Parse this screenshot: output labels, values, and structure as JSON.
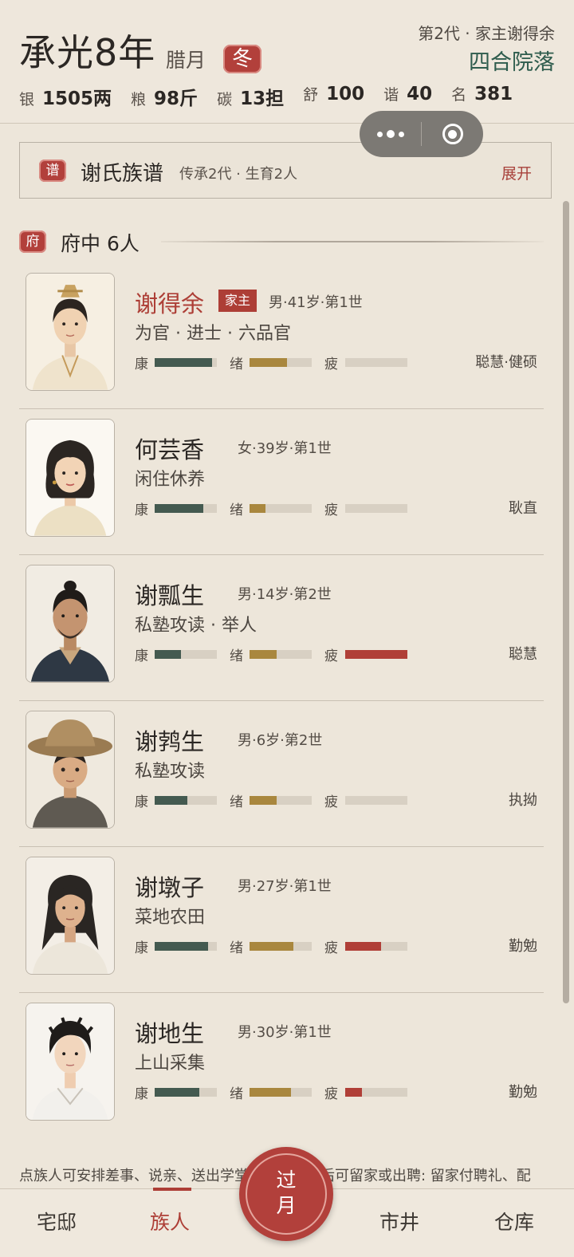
{
  "header": {
    "year": "承光8年",
    "month": "腊月",
    "season": "冬",
    "generation": "第2代 · 家主谢得余",
    "estate": "四合院落",
    "resources": [
      {
        "label": "银",
        "value": "1505两"
      },
      {
        "label": "粮",
        "value": "98斤"
      },
      {
        "label": "碳",
        "value": "13担"
      },
      {
        "label": "舒",
        "value": "100"
      },
      {
        "label": "谐",
        "value": "40"
      },
      {
        "label": "名",
        "value": "381"
      }
    ]
  },
  "genealogy": {
    "seal": "谱",
    "title": "谢氏族谱",
    "subtitle": "传承2代 · 生育2人",
    "expand": "展开"
  },
  "household": {
    "seal": "府",
    "title": "府中 6人"
  },
  "stat_labels": {
    "health": "康",
    "mood": "绪",
    "fatigue": "疲"
  },
  "colors": {
    "health": "#445a50",
    "mood": "#a9873e",
    "fatigue": "#b03f37",
    "accent": "#ad3e36"
  },
  "members": [
    {
      "name": "谢得余",
      "badge": "家主",
      "meta": "男·41岁·第1世",
      "occupation": "为官 · 进士 · 六品官",
      "traits": "聪慧·健硕",
      "health": 0.92,
      "mood": 0.6,
      "fatigue": 0.0,
      "portrait": "official-man"
    },
    {
      "name": "何芸香",
      "badge": "",
      "meta": "女·39岁·第1世",
      "occupation": "闲住休养",
      "traits": "耿直",
      "health": 0.78,
      "mood": 0.25,
      "fatigue": 0.0,
      "portrait": "woman"
    },
    {
      "name": "谢瓢生",
      "badge": "",
      "meta": "男·14岁·第2世",
      "occupation": "私塾攻读 · 举人",
      "traits": "聪慧",
      "health": 0.42,
      "mood": 0.43,
      "fatigue": 1.0,
      "portrait": "bearded-man"
    },
    {
      "name": "谢鹁生",
      "badge": "",
      "meta": "男·6岁·第2世",
      "occupation": "私塾攻读",
      "traits": "执拗",
      "health": 0.52,
      "mood": 0.44,
      "fatigue": 0.0,
      "portrait": "child-straw-hat"
    },
    {
      "name": "谢墩子",
      "badge": "",
      "meta": "男·27岁·第1世",
      "occupation": "菜地农田",
      "traits": "勤勉",
      "health": 0.86,
      "mood": 0.7,
      "fatigue": 0.58,
      "portrait": "long-hair-man"
    },
    {
      "name": "谢地生",
      "badge": "",
      "meta": "男·30岁·第1世",
      "occupation": "上山采集",
      "traits": "勤勉",
      "health": 0.72,
      "mood": 0.67,
      "fatigue": 0.27,
      "portrait": "young-man"
    }
  ],
  "footer_note": "点族人可安排差事、说亲、送出学堂，女儿成年后可留家或出聘: 留家付聘礼、配",
  "nav": {
    "items": [
      "宅邸",
      "族人",
      "市井",
      "仓库"
    ],
    "active": "族人",
    "advance": "过月"
  }
}
